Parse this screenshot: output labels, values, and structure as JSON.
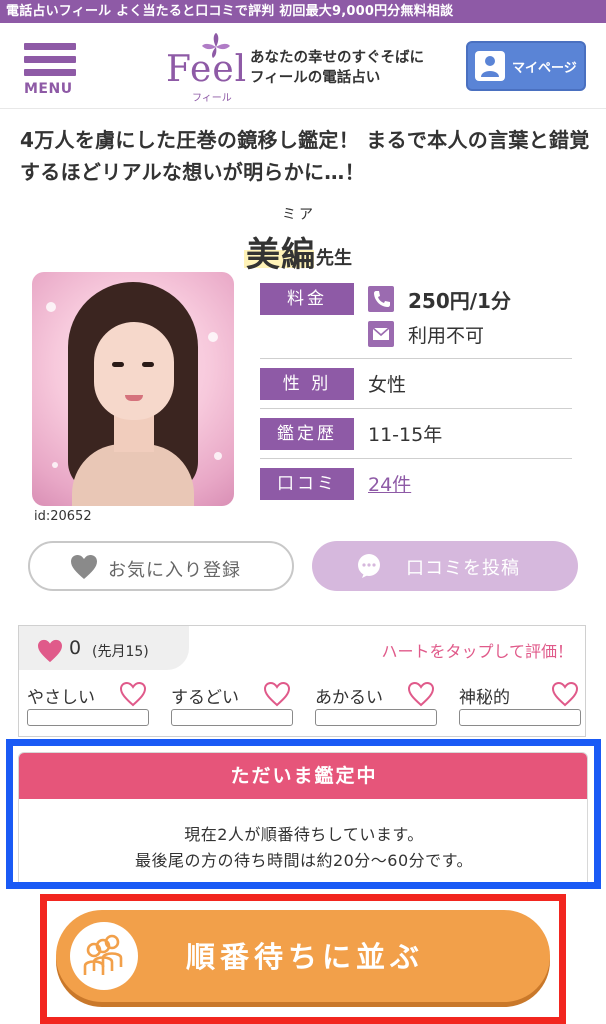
{
  "topbar": {
    "text": "電話占いフィール よく当たると口コミで評判 初回最大9,000円分無料相談"
  },
  "header": {
    "menu_label": "MENU",
    "logo_text": "Feel",
    "logo_sub": "フィール",
    "tagline_line1": "あなたの幸せのすぐそばに",
    "tagline_line2": "フィールの電話占い",
    "mypage_label": "マイページ"
  },
  "headline": "4万人を虜にした圧巻の鏡移し鑑定！ まるで本人の言葉と錯覚するほどリアルな想いが明らかに…！",
  "profile": {
    "name_ruby": "ミア",
    "name": "美編",
    "name_suffix": "先生",
    "id_label": "id:20652",
    "fee_label": "料金",
    "fee_value": "250円/1分",
    "mail_value": "利用不可",
    "gender_label": "性 別",
    "gender_value": "女性",
    "career_label": "鑑定歴",
    "career_value": "11-15年",
    "review_label": "口コミ",
    "review_value": "24件"
  },
  "actions": {
    "favorite_label": "お気に入り登録",
    "post_review_label": "口コミを投稿"
  },
  "evaluation": {
    "heart_count": "0",
    "heart_sub": "(先月15)",
    "hint": "ハートをタップして評価！",
    "traits": [
      {
        "label": "やさしい",
        "level": 0
      },
      {
        "label": "するどい",
        "level": 0
      },
      {
        "label": "あかるい",
        "level": 0
      },
      {
        "label": "神秘的",
        "level": 0
      }
    ]
  },
  "status": {
    "title": "ただいま鑑定中",
    "line1": "現在2人が順番待ちしています。",
    "line2": "最後尾の方の待ち時間は約20分〜60分です。"
  },
  "queue": {
    "label": "順番待ちに並ぶ"
  },
  "colors": {
    "brand": "#8e5aa6",
    "status_head": "#e6557a",
    "queue_button": "#f2a04a",
    "mypage_button": "#5a84d6",
    "highlight_blue": "#1a5af5",
    "highlight_red": "#f2261f"
  }
}
